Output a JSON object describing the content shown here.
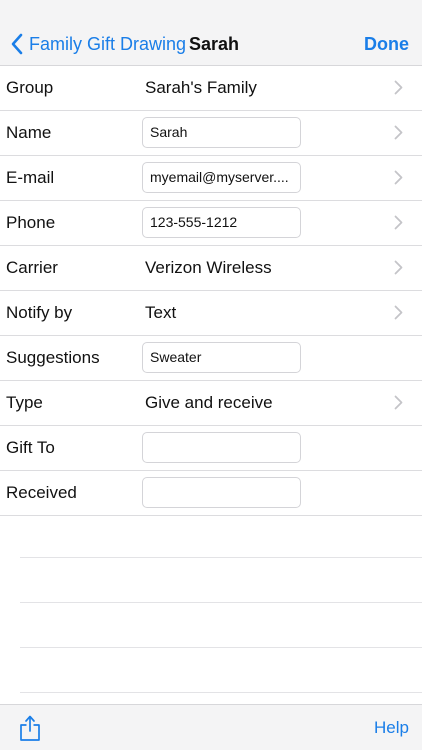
{
  "nav": {
    "back_label": "Family Gift Drawing",
    "title": "Sarah",
    "done_label": "Done"
  },
  "rows": {
    "group": {
      "label": "Group",
      "value": "Sarah's Family"
    },
    "name": {
      "label": "Name",
      "value": "Sarah"
    },
    "email": {
      "label": "E-mail",
      "value": "myemail@myserver...."
    },
    "phone": {
      "label": "Phone",
      "value": "123-555-1212"
    },
    "carrier": {
      "label": "Carrier",
      "value": "Verizon Wireless"
    },
    "notify": {
      "label": "Notify by",
      "value": "Text"
    },
    "suggestions": {
      "label": "Suggestions",
      "value": "Sweater"
    },
    "type": {
      "label": "Type",
      "value": "Give and receive"
    },
    "gift_to": {
      "label": "Gift To",
      "value": ""
    },
    "received": {
      "label": "Received",
      "value": ""
    }
  },
  "toolbar": {
    "help_label": "Help",
    "share_icon": "share-icon"
  },
  "colors": {
    "accent": "#1a7ee8",
    "bar_background": "#f4f4f5",
    "separator": "#dcdcdf",
    "chevron": "#c4c4c8"
  }
}
